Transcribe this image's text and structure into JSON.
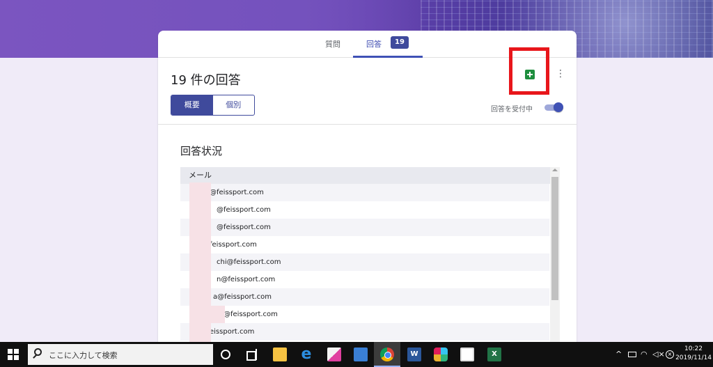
{
  "tabs": {
    "questions_label": "質問",
    "responses_label": "回答",
    "responses_count": "19"
  },
  "summary": {
    "title": "19 件の回答",
    "view_summary_label": "概要",
    "view_individual_label": "個別",
    "accepting_label": "回答を受付中",
    "accepting_on": true
  },
  "section": {
    "title": "回答状況",
    "column_header": "メール",
    "rows": [
      "@feissport.com",
      "@feissport.com",
      "@feissport.com",
      "feissport.com",
      "chi@feissport.com",
      "n@feissport.com",
      "a@feissport.com",
      "@feissport.com",
      "eissport.com"
    ]
  },
  "taskbar": {
    "search_placeholder": "ここに入力して検索",
    "word_letter": "W",
    "excel_letter": "X",
    "ie_letter": "e",
    "time": "10:22",
    "date": "2019/11/14"
  },
  "colors": {
    "accent": "#3f4a9c",
    "sheets_green": "#1e8e3e",
    "highlight_red": "#e8161b"
  }
}
